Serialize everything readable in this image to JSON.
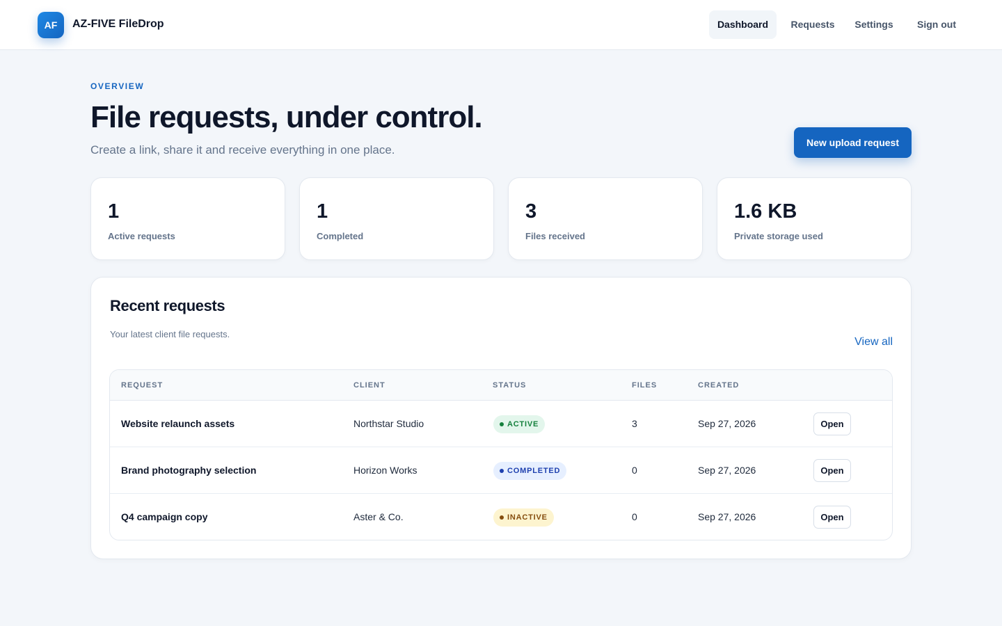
{
  "header": {
    "logo_initials": "AF",
    "brand": "AZ-FIVE FileDrop",
    "nav": [
      {
        "label": "Dashboard",
        "active": true
      },
      {
        "label": "Requests",
        "active": false
      },
      {
        "label": "Settings",
        "active": false
      },
      {
        "label": "Sign out",
        "active": false
      }
    ]
  },
  "hero": {
    "eyebrow": "OVERVIEW",
    "title": "File requests, under control.",
    "subtitle": "Create a link, share it and receive everything in one place.",
    "cta_label": "New upload request"
  },
  "stats": [
    {
      "value": "1",
      "label": "Active requests"
    },
    {
      "value": "1",
      "label": "Completed"
    },
    {
      "value": "3",
      "label": "Files received"
    },
    {
      "value": "1.6 KB",
      "label": "Private storage used"
    }
  ],
  "recent": {
    "title": "Recent requests",
    "subtitle": "Your latest client file requests.",
    "view_all": "View all",
    "columns": [
      "REQUEST",
      "CLIENT",
      "STATUS",
      "FILES",
      "CREATED"
    ],
    "rows": [
      {
        "request": "Website relaunch assets",
        "client": "Northstar Studio",
        "status": "ACTIVE",
        "files": "3",
        "created": "Sep 27, 2026",
        "action": "Open"
      },
      {
        "request": "Brand photography selection",
        "client": "Horizon Works",
        "status": "COMPLETED",
        "files": "0",
        "created": "Sep 27, 2026",
        "action": "Open"
      },
      {
        "request": "Q4 campaign copy",
        "client": "Aster & Co.",
        "status": "INACTIVE",
        "files": "0",
        "created": "Sep 27, 2026",
        "action": "Open"
      }
    ]
  },
  "colors": {
    "accent": "#1565c0",
    "status_active_bg": "#e3f6ec",
    "status_active_fg": "#15803d",
    "status_completed_bg": "#e6efff",
    "status_completed_fg": "#1e40af",
    "status_inactive_bg": "#fdf4cf",
    "status_inactive_fg": "#854d0e"
  }
}
